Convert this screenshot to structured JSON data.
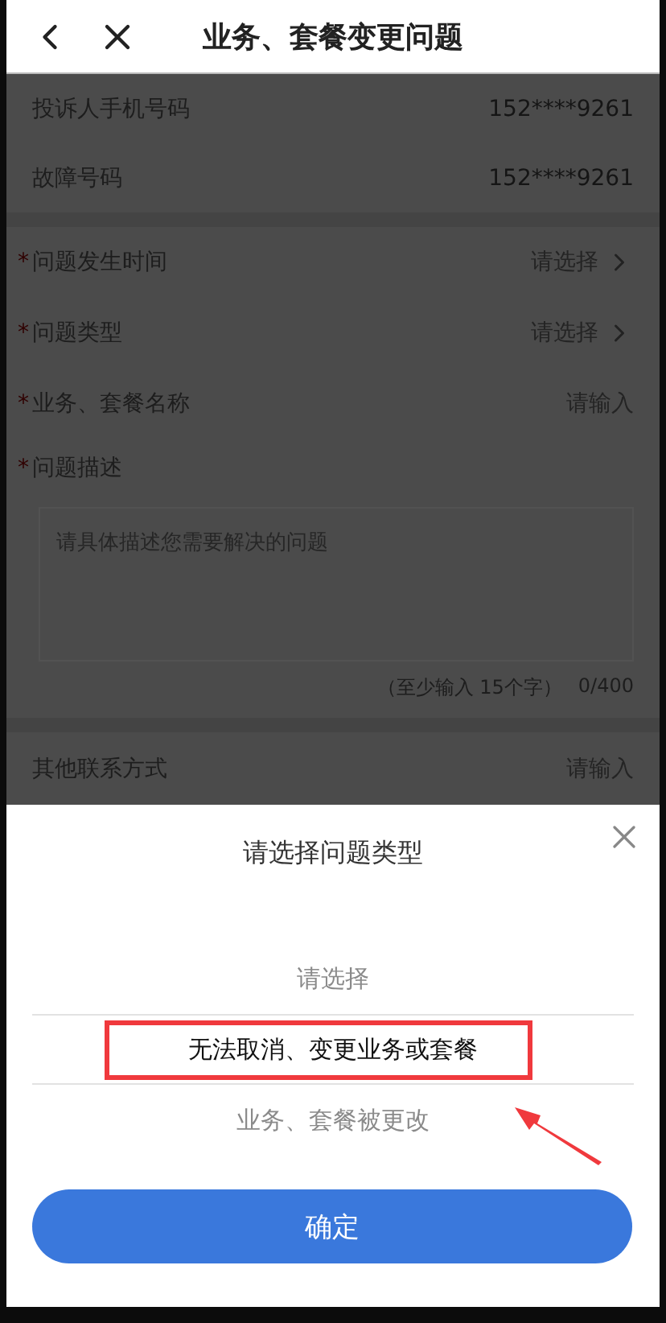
{
  "header": {
    "title": "业务、套餐变更问题"
  },
  "info_rows": [
    {
      "label": "投诉人手机号码",
      "value": "152****9261"
    },
    {
      "label": "故障号码",
      "value": "152****9261"
    }
  ],
  "required_mark": "*",
  "fields": [
    {
      "kind": "select",
      "label": "问题发生时间",
      "required": true,
      "placeholder": "请选择"
    },
    {
      "kind": "select",
      "label": "问题类型",
      "required": true,
      "placeholder": "请选择"
    },
    {
      "kind": "input",
      "label": "业务、套餐名称",
      "required": true,
      "placeholder": "请输入"
    },
    {
      "kind": "textarea",
      "label": "问题描述",
      "required": true,
      "placeholder": "请具体描述您需要解决的问题",
      "hint": "（至少输入 15个字）",
      "counter": "0/400"
    }
  ],
  "contact": {
    "label": "其他联系方式",
    "placeholder": "请输入"
  },
  "sheet": {
    "title": "请选择问题类型",
    "options": [
      {
        "label": "请选择",
        "selected": false
      },
      {
        "label": "无法取消、变更业务或套餐",
        "selected": true
      },
      {
        "label": "业务、套餐被更改",
        "selected": false
      }
    ],
    "confirm": "确定"
  }
}
